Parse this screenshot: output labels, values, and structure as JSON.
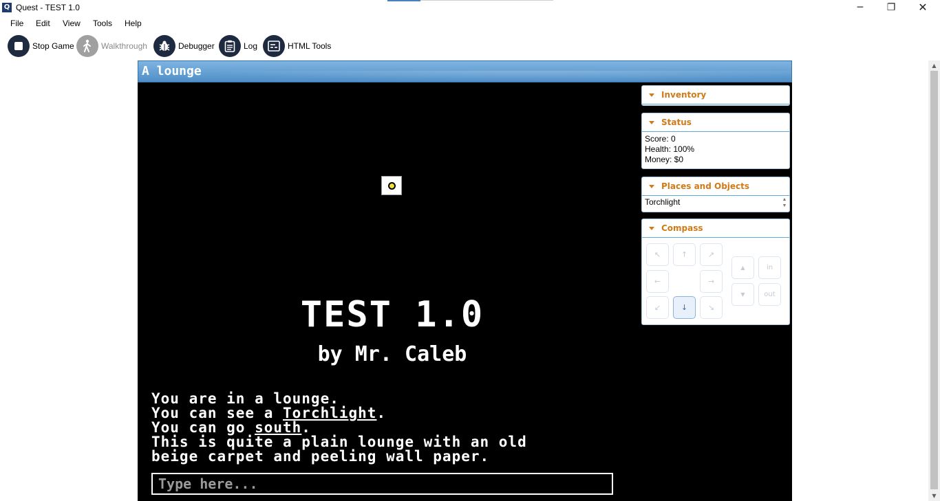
{
  "window": {
    "title": "Quest - TEST 1.0",
    "icon_label": "Q",
    "minimize": "─",
    "maximize": "❐",
    "close": "✕"
  },
  "menu": [
    "File",
    "Edit",
    "View",
    "Tools",
    "Help"
  ],
  "toolbar": {
    "stop_game": "Stop Game",
    "walkthrough": "Walkthrough",
    "debugger": "Debugger",
    "log": "Log",
    "html_tools": "HTML Tools"
  },
  "game": {
    "location": "A lounge",
    "title": "TEST 1.0",
    "author": "by Mr. Caleb",
    "output": {
      "line1": "You are in a lounge.",
      "line2_pre": "You can see a ",
      "line2_link": "Torchlight",
      "line2_post": ".",
      "line3_pre": "You can go ",
      "line3_link": "south",
      "line3_post": ".",
      "line4": "This is quite a plain lounge with an old",
      "line5": "beige carpet and peeling wall paper."
    },
    "command_placeholder": "Type here..."
  },
  "panes": {
    "inventory": {
      "title": "Inventory"
    },
    "status": {
      "title": "Status",
      "score": "Score: 0",
      "health": "Health: 100%",
      "money": "Money: $0"
    },
    "places": {
      "title": "Places and Objects",
      "items": [
        "Torchlight"
      ]
    },
    "compass": {
      "title": "Compass",
      "nw": "↖",
      "n": "↑",
      "ne": "↗",
      "w": "←",
      "e": "→",
      "sw": "↙",
      "s": "↓",
      "se": "↘",
      "up": "▲",
      "down": "▼",
      "in": "in",
      "out": "out",
      "active": "south"
    }
  },
  "colors": {
    "accent": "#d07a18",
    "location_bar": "#5f9fd4",
    "game_bg": "#000000"
  }
}
